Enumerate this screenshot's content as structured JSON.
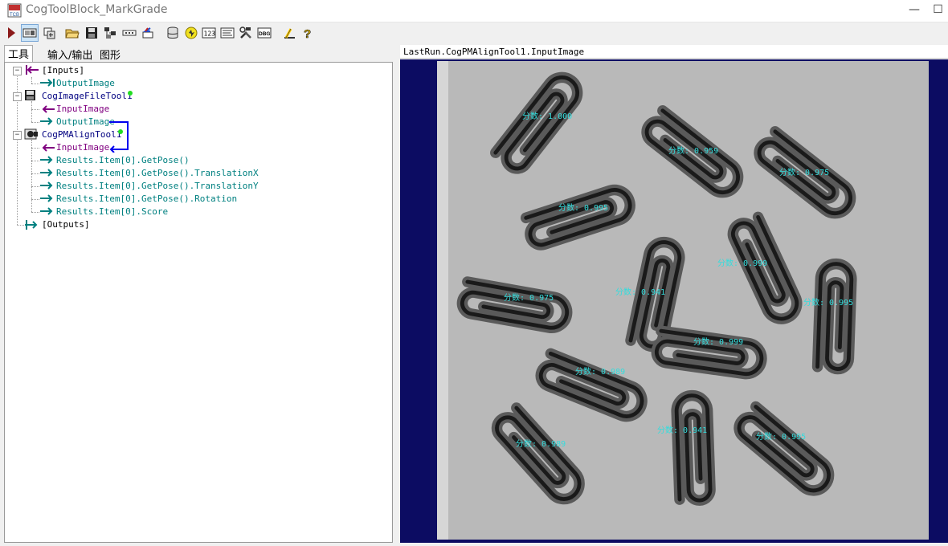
{
  "window": {
    "title": "CogToolBlock_MarkGrade",
    "minimize_glyph": "—",
    "maximize_glyph": "☐"
  },
  "toolbar": {
    "buttons": [
      "run-icon",
      "show-image-icon",
      "add-tool-icon",
      "open-folder-icon",
      "save-icon",
      "network-icon",
      "dots-icon",
      "reset-icon",
      "database-icon",
      "light-icon",
      "123-icon",
      "script-icon",
      "tools-icon",
      "dbg-icon",
      "measure-icon",
      "help-icon"
    ]
  },
  "tabs": [
    {
      "label": "工具",
      "active": true
    },
    {
      "label": "输入/输出",
      "active": false
    },
    {
      "label": "图形",
      "active": false
    }
  ],
  "tree": {
    "inputs": "[Inputs]",
    "inputs_output_image": "OutputImage",
    "file_tool": "CogImageFileTool1",
    "file_tool_input": "InputImage",
    "file_tool_output": "OutputImage",
    "pm_tool": "CogPMAlignTool1",
    "pm_tool_input": "InputImage",
    "results": [
      "Results.Item[0].GetPose()",
      "Results.Item[0].GetPose().TranslationX",
      "Results.Item[0].GetPose().TranslationY",
      "Results.Item[0].GetPose().Rotation",
      "Results.Item[0].Score"
    ],
    "outputs": "[Outputs]"
  },
  "image_panel": {
    "header": "LastRun.CogPMAlignTool1.InputImage",
    "score_prefix": "分数",
    "scores": [
      "1.000",
      "0.959",
      "0.975",
      "0.995",
      "0.999",
      "0.975",
      "0.941",
      "0.995",
      "0.999",
      "0.989",
      "0.941",
      "0.989",
      "0.995"
    ]
  },
  "colors": {
    "input_arrow": "#800080",
    "output_arrow": "#008080",
    "tree_text_purple": "#800080",
    "tree_text_teal": "#008080",
    "image_bg": "#0c0c62",
    "paper": "#b8b8b8",
    "score_label": "#33dddd",
    "link_line": "#0000ee"
  }
}
